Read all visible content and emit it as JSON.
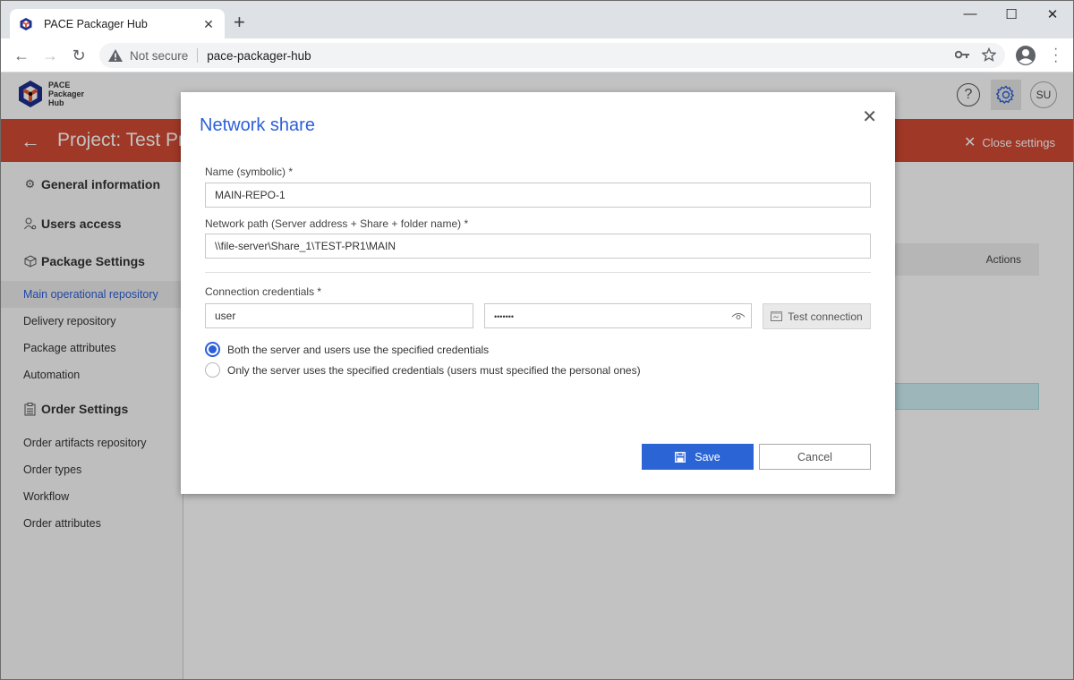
{
  "browser": {
    "tab_title": "PACE Packager Hub",
    "security_label": "Not secure",
    "url": "pace-packager-hub"
  },
  "app": {
    "logo_lines": [
      "PACE",
      "Packager",
      "Hub"
    ],
    "help_label": "?",
    "avatar_initials": "SU",
    "project_title": "Project: Test Project",
    "close_settings_label": "Close settings",
    "brand_color": "#d24a33",
    "accent_color": "#2b5fd9"
  },
  "sidebar": {
    "sections": [
      {
        "label": "General information",
        "icon": "gear-icon"
      },
      {
        "label": "Users access",
        "icon": "users-icon"
      },
      {
        "label": "Package Settings",
        "icon": "package-icon"
      },
      {
        "label": "Order Settings",
        "icon": "clipboard-icon"
      }
    ],
    "package_items": [
      {
        "label": "Main operational repository",
        "active": true
      },
      {
        "label": "Delivery repository",
        "active": false
      },
      {
        "label": "Package attributes",
        "active": false
      },
      {
        "label": "Automation",
        "active": false
      }
    ],
    "order_items": [
      {
        "label": "Order artifacts repository"
      },
      {
        "label": "Order types"
      },
      {
        "label": "Workflow"
      },
      {
        "label": "Order attributes"
      }
    ]
  },
  "main": {
    "table_header_actions": "Actions"
  },
  "modal": {
    "title": "Network share",
    "name_label": "Name (symbolic) *",
    "name_value": "MAIN-REPO-1",
    "path_label": "Network path (Server address + Share + folder name) *",
    "path_value": "\\\\file-server\\Share_1\\TEST-PR1\\MAIN",
    "credentials_label": "Connection credentials *",
    "username_value": "user",
    "password_masked": "•••••••",
    "test_connection_label": "Test connection",
    "radio_options": [
      {
        "label": "Both the server and users use the specified credentials",
        "selected": true
      },
      {
        "label": "Only the server uses the specified credentials (users must specified the personal ones)",
        "selected": false
      }
    ],
    "save_label": "Save",
    "cancel_label": "Cancel"
  }
}
